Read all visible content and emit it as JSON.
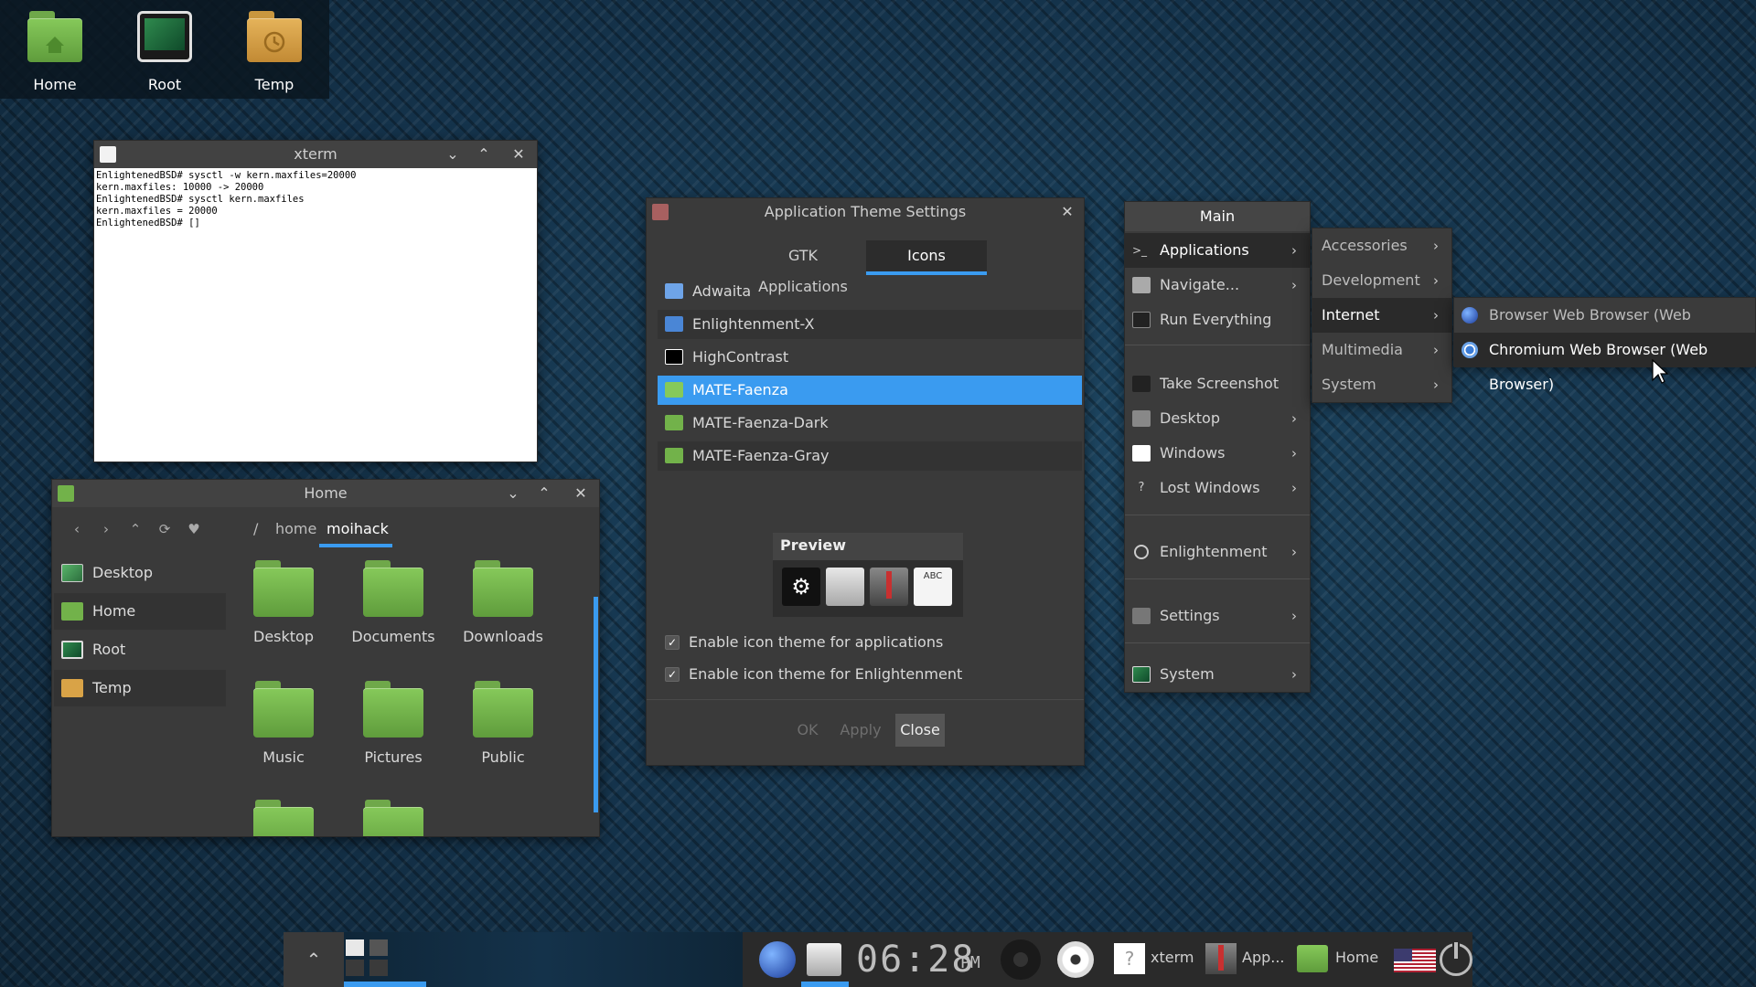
{
  "desktop": {
    "icons": [
      {
        "label": "Home"
      },
      {
        "label": "Root"
      },
      {
        "label": "Temp"
      }
    ]
  },
  "xterm": {
    "title": "xterm",
    "lines": [
      "EnlightenedBSD# sysctl -w kern.maxfiles=20000",
      "kern.maxfiles: 10000 -> 20000",
      "EnlightenedBSD# sysctl kern.maxfiles",
      "kern.maxfiles = 20000",
      "EnlightenedBSD# []"
    ]
  },
  "filemanager": {
    "title": "Home",
    "breadcrumb": [
      "/",
      "home",
      "moihack"
    ],
    "sidebar": [
      {
        "label": "Desktop"
      },
      {
        "label": "Home"
      },
      {
        "label": "Root"
      },
      {
        "label": "Temp"
      }
    ],
    "folders": [
      {
        "label": "Desktop"
      },
      {
        "label": "Documents"
      },
      {
        "label": "Downloads"
      },
      {
        "label": "Music"
      },
      {
        "label": "Pictures"
      },
      {
        "label": "Public"
      }
    ]
  },
  "theme_dialog": {
    "title": "Application Theme Settings",
    "tabs": [
      "GTK Applications",
      "Icons"
    ],
    "active_tab": "Icons",
    "themes": [
      {
        "label": "Adwaita"
      },
      {
        "label": "Enlightenment-X"
      },
      {
        "label": "HighContrast"
      },
      {
        "label": "MATE-Faenza"
      },
      {
        "label": "MATE-Faenza-Dark"
      },
      {
        "label": "MATE-Faenza-Gray"
      }
    ],
    "selected_theme": "MATE-Faenza",
    "preview_label": "Preview",
    "preview_abc": "ABC",
    "checkboxes": [
      {
        "label": "Enable icon theme for applications",
        "checked": true
      },
      {
        "label": "Enable icon theme for Enlightenment",
        "checked": true
      }
    ],
    "buttons": {
      "ok": "OK",
      "apply": "Apply",
      "close": "Close"
    }
  },
  "main_menu": {
    "header": "Main",
    "items": [
      {
        "label": "Applications",
        "submenu": true
      },
      {
        "label": "Navigate...",
        "submenu": true
      },
      {
        "label": "Run Everything",
        "submenu": false
      },
      {
        "label": "Take Screenshot",
        "submenu": false
      },
      {
        "label": "Desktop",
        "submenu": true
      },
      {
        "label": "Windows",
        "submenu": true
      },
      {
        "label": "Lost Windows",
        "submenu": true
      },
      {
        "label": "Enlightenment",
        "submenu": true
      },
      {
        "label": "Settings",
        "submenu": true
      },
      {
        "label": "System",
        "submenu": true
      }
    ],
    "applications_submenu": [
      {
        "label": "Accessories"
      },
      {
        "label": "Development"
      },
      {
        "label": "Internet"
      },
      {
        "label": "Multimedia"
      },
      {
        "label": "System"
      }
    ],
    "internet_submenu": [
      {
        "label": "Browser Web Browser (Web Browser)"
      },
      {
        "label": "Chromium Web Browser (Web Browser)"
      }
    ]
  },
  "taskbar": {
    "clock_time": "06:28",
    "clock_ampm": "PM",
    "tasks": [
      {
        "label": "xterm"
      },
      {
        "label": "App..."
      },
      {
        "label": "Home"
      }
    ]
  },
  "colors": {
    "selection": "#3a9bf0",
    "folder_green": "#72b24a",
    "desktop_bg": "#14324a"
  }
}
